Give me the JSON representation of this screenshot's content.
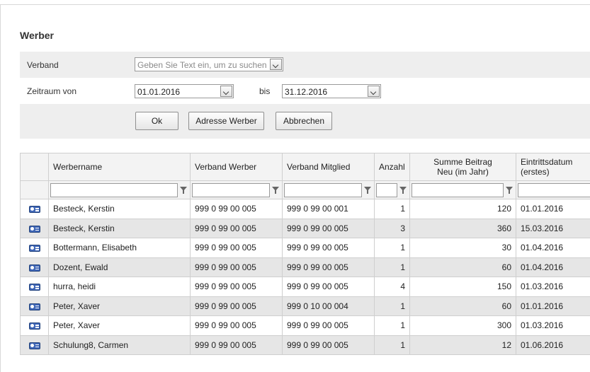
{
  "title": "Werber",
  "form": {
    "verband_label": "Verband",
    "verband_placeholder": "Geben Sie Text ein, um zu suchen",
    "zeitraum_label": "Zeitraum von",
    "date_from": "01.01.2016",
    "bis_label": "bis",
    "date_to": "31.12.2016"
  },
  "buttons": {
    "ok": "Ok",
    "adresse": "Adresse Werber",
    "abbrechen": "Abbrechen"
  },
  "columns": {
    "werbername": "Werbername",
    "verband_werber": "Verband Werber",
    "verband_mitglied": "Verband Mitglied",
    "anzahl": "Anzahl",
    "summe_line1": "Summe Beitrag",
    "summe_line2": "Neu (im Jahr)",
    "eintritt_line1": "Eintrittsdatum",
    "eintritt_line2": "(erstes)"
  },
  "rows": [
    {
      "name": "Besteck, Kerstin",
      "verband_werber": "999 0 99 00 005",
      "verband_mitglied": "999 0 99 00 001",
      "anzahl": "1",
      "summe": "120",
      "eintritt": "01.01.2016"
    },
    {
      "name": "Besteck, Kerstin",
      "verband_werber": "999 0 99 00 005",
      "verband_mitglied": "999 0 99 00 005",
      "anzahl": "3",
      "summe": "360",
      "eintritt": "15.03.2016"
    },
    {
      "name": "Bottermann, Elisabeth",
      "verband_werber": "999 0 99 00 005",
      "verband_mitglied": "999 0 99 00 005",
      "anzahl": "1",
      "summe": "30",
      "eintritt": "01.04.2016"
    },
    {
      "name": "Dozent, Ewald",
      "verband_werber": "999 0 99 00 005",
      "verband_mitglied": "999 0 99 00 005",
      "anzahl": "1",
      "summe": "60",
      "eintritt": "01.04.2016"
    },
    {
      "name": "hurra, heidi",
      "verband_werber": "999 0 99 00 005",
      "verband_mitglied": "999 0 99 00 005",
      "anzahl": "4",
      "summe": "150",
      "eintritt": "01.03.2016"
    },
    {
      "name": "Peter, Xaver",
      "verband_werber": "999 0 99 00 005",
      "verband_mitglied": "999 0 10 00 004",
      "anzahl": "1",
      "summe": "60",
      "eintritt": "01.01.2016"
    },
    {
      "name": "Peter, Xaver",
      "verband_werber": "999 0 99 00 005",
      "verband_mitglied": "999 0 99 00 005",
      "anzahl": "1",
      "summe": "300",
      "eintritt": "01.03.2016"
    },
    {
      "name": "Schulung8, Carmen",
      "verband_werber": "999 0 99 00 005",
      "verband_mitglied": "999 0 99 00 005",
      "anzahl": "1",
      "summe": "12",
      "eintritt": "01.06.2016"
    }
  ],
  "icons": {
    "row_icon": "contact-card-icon",
    "filter_icon": "filter-icon",
    "dropdown_icon": "chevron-down-icon"
  },
  "colors": {
    "alt_row": "#e6e6e6",
    "band": "#eeeeee",
    "card_icon": "#3f66b6"
  }
}
